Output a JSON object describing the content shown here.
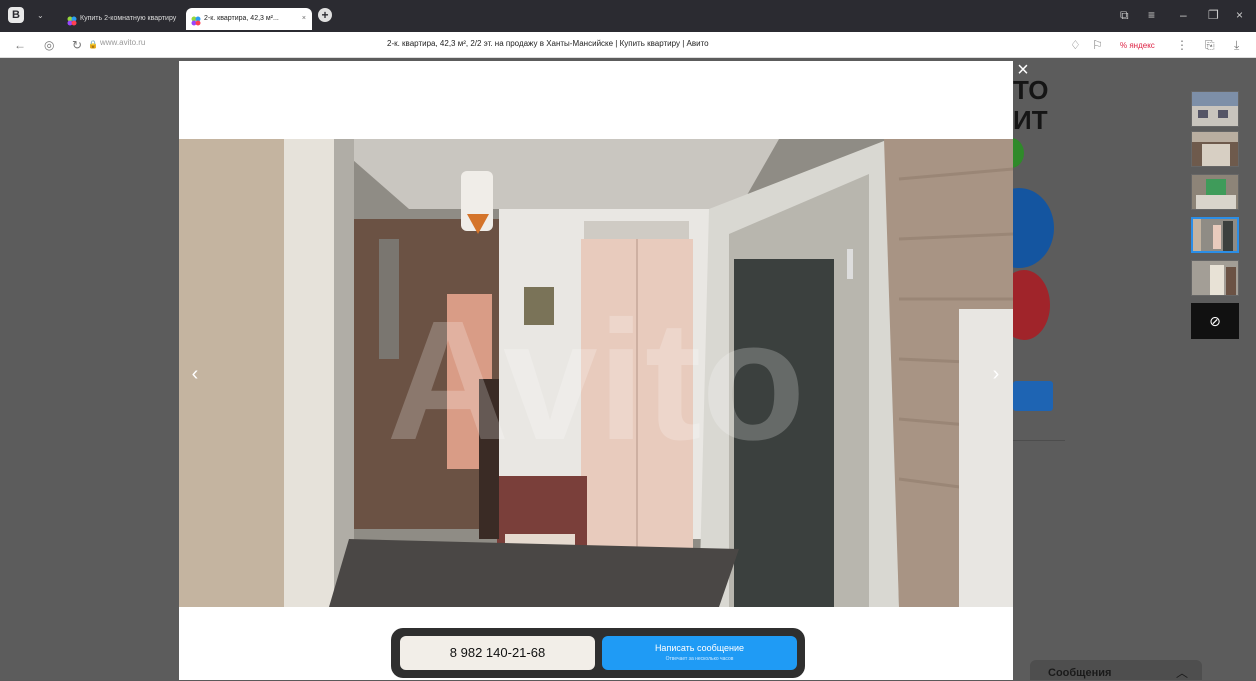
{
  "browser": {
    "tabs": [
      {
        "label": "Купить 2-комнатную квартиру",
        "active": false
      },
      {
        "label": "2-к. квартира, 42,3 м²...",
        "active": true
      }
    ],
    "url": "www.avito.ru",
    "page_title": "2-к. квартира, 42,3 м², 2/2 эт. на продажу в Ханты-Мансийске | Купить квартиру | Авито",
    "translate_label": "% яндекс"
  },
  "background_page": {
    "fragment_1": "ТО",
    "fragment_2": "ИТ",
    "messages_label": "Сообщения"
  },
  "gallery": {
    "watermark": "Avito",
    "prev_icon": "chevron-left-icon",
    "next_icon": "chevron-right-icon",
    "close_icon": "close-icon",
    "thumbnails": [
      {
        "name": "building-exterior",
        "selected": false
      },
      {
        "name": "balcony",
        "selected": false
      },
      {
        "name": "kitchen",
        "selected": false
      },
      {
        "name": "hallway",
        "selected": true
      },
      {
        "name": "room",
        "selected": false
      }
    ]
  },
  "contact": {
    "phone": "8 982 140-21-68",
    "message_button": "Написать сообщение",
    "message_sub": "Отвечает за несколько часов"
  },
  "colors": {
    "accent": "#1f9bf5",
    "dark_panel": "#2f2f2f"
  }
}
